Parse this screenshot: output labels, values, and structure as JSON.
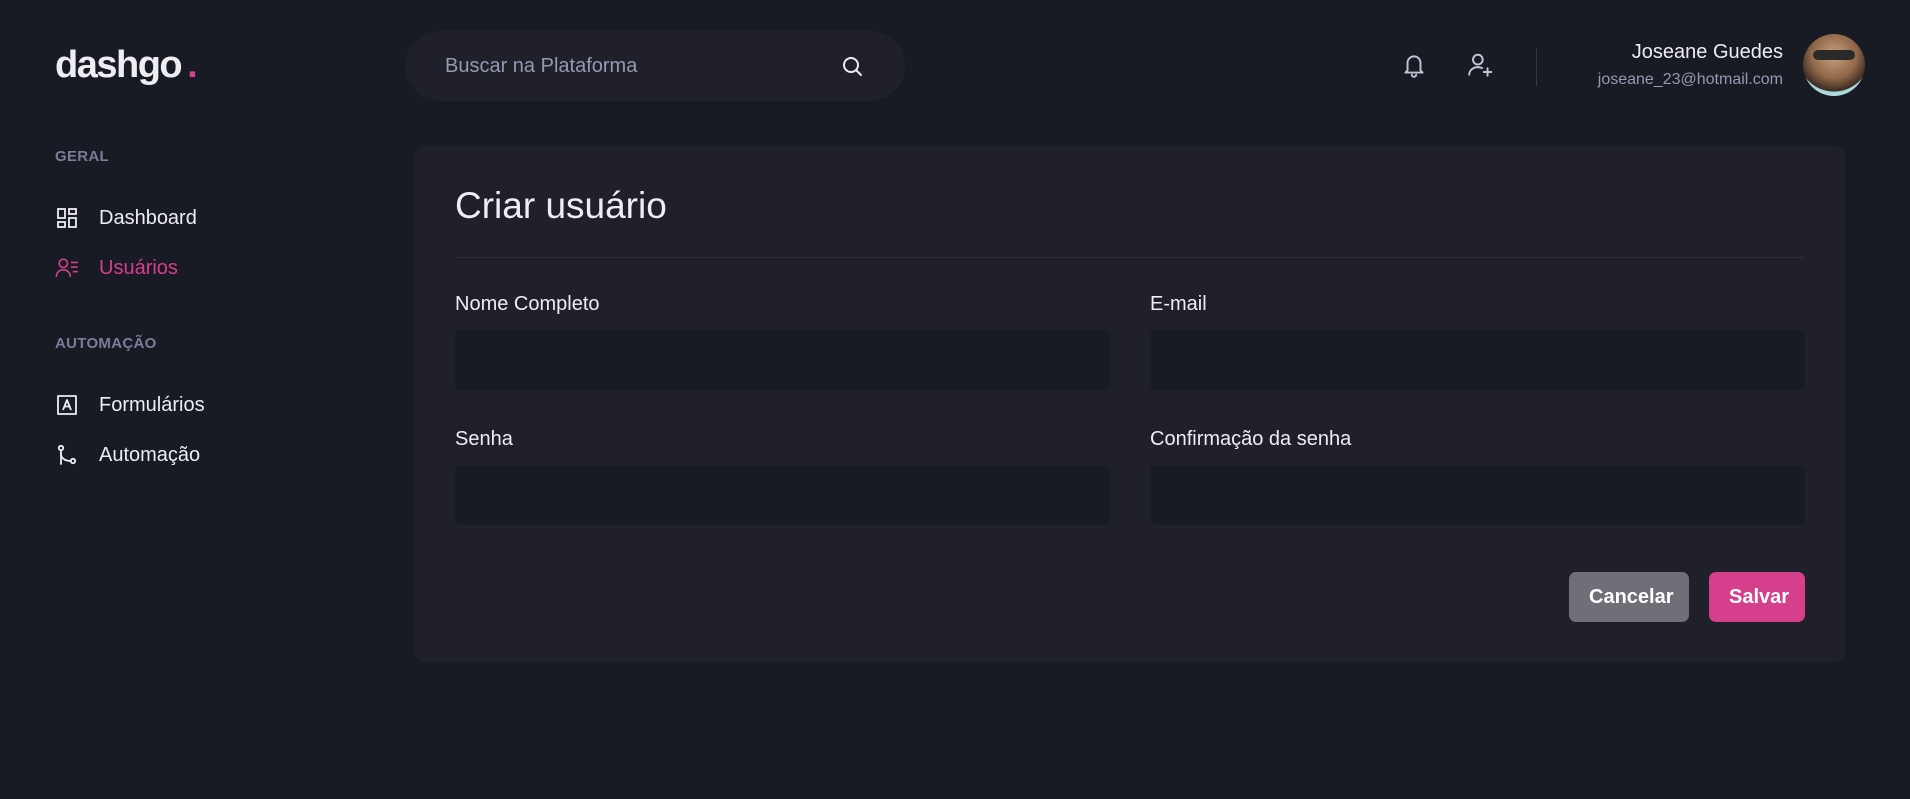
{
  "brand": {
    "name": "dashgo",
    "dot": ".",
    "accent": "#d53f8c"
  },
  "search": {
    "placeholder": "Buscar na Plataforma",
    "value": ""
  },
  "header": {
    "icons": [
      "bell-icon",
      "user-add-icon"
    ]
  },
  "profile": {
    "name": "Joseane Guedes",
    "email": "joseane_23@hotmail.com"
  },
  "sidebar": {
    "sections": [
      {
        "title": "GERAL",
        "items": [
          {
            "label": "Dashboard",
            "icon": "dashboard-icon",
            "active": false
          },
          {
            "label": "Usuários",
            "icon": "users-icon",
            "active": true
          }
        ]
      },
      {
        "title": "AUTOMAÇÃO",
        "items": [
          {
            "label": "Formulários",
            "icon": "form-icon",
            "active": false
          },
          {
            "label": "Automação",
            "icon": "git-branch-icon",
            "active": false
          }
        ]
      }
    ]
  },
  "form": {
    "title": "Criar usuário",
    "fields": [
      {
        "label": "Nome Completo",
        "value": ""
      },
      {
        "label": "E-mail",
        "value": ""
      },
      {
        "label": "Senha",
        "value": ""
      },
      {
        "label": "Confirmação da senha",
        "value": ""
      }
    ],
    "cancel_label": "Cancelar",
    "save_label": "Salvar"
  }
}
